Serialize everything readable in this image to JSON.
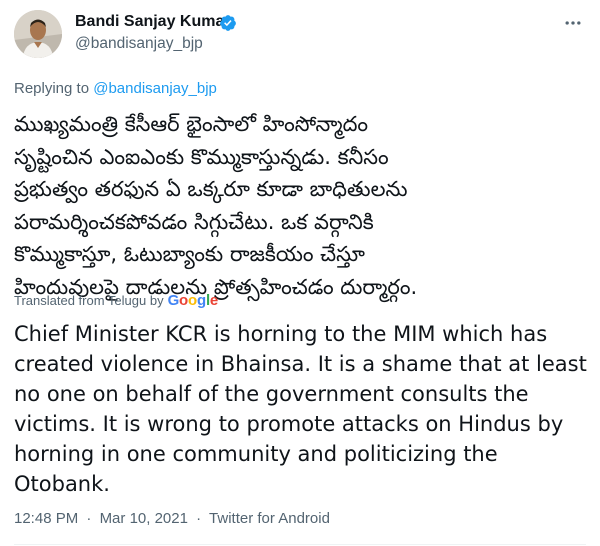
{
  "author": {
    "name": "Bandi Sanjay Kumar",
    "handle": "@bandisanjay_bjp",
    "verified": true,
    "verified_color": "#1d9bf0"
  },
  "reply": {
    "prefix": "Replying to",
    "handle": "@bandisanjay_bjp"
  },
  "tweet": {
    "original_lines": [
      "ముఖ్యమంత్రి కేసీఆర్ భైంసాలో హింసోన్మాదం",
      "సృష్టించిన ఎంఐఎంకు కొమ్ముకాస్తున్నడు. కనీసం",
      "ప్రభుత్వం తరఫున ఏ ఒక్కరూ కూడా బాధితులను",
      "పరామర్శించకపోవడం సిగ్గుచేటు. ఒక వర్గానికి",
      "కొమ్ముకాస్తూ, ఓటుబ్యాంకు రాజకీయం చేస్తూ",
      "హిందువులపై దాడులను ప్రోత్సహించడం దుర్మార్గం."
    ],
    "translated_from": "Translated from Telugu by",
    "translator": {
      "letters": [
        "G",
        "o",
        "o",
        "g",
        "l",
        "e"
      ]
    },
    "translation_lines": [
      "Chief Minister KCR is horning to the MIM which has",
      "created violence in Bhainsa. It is a shame that at least",
      "no one on behalf of the government consults the",
      "victims. It is wrong to promote attacks on Hindus by",
      "horning in one community and politicizing the",
      "Otobank."
    ]
  },
  "meta": {
    "time": "12:48 PM",
    "separator": "·",
    "date": "Mar 10, 2021",
    "source": "Twitter for Android"
  },
  "colors": {
    "text": "#0f1419",
    "secondary": "#536471",
    "link": "#1d9bf0"
  },
  "icons": {
    "more": "more-horizontal-icon",
    "verified": "verified-badge-icon"
  }
}
